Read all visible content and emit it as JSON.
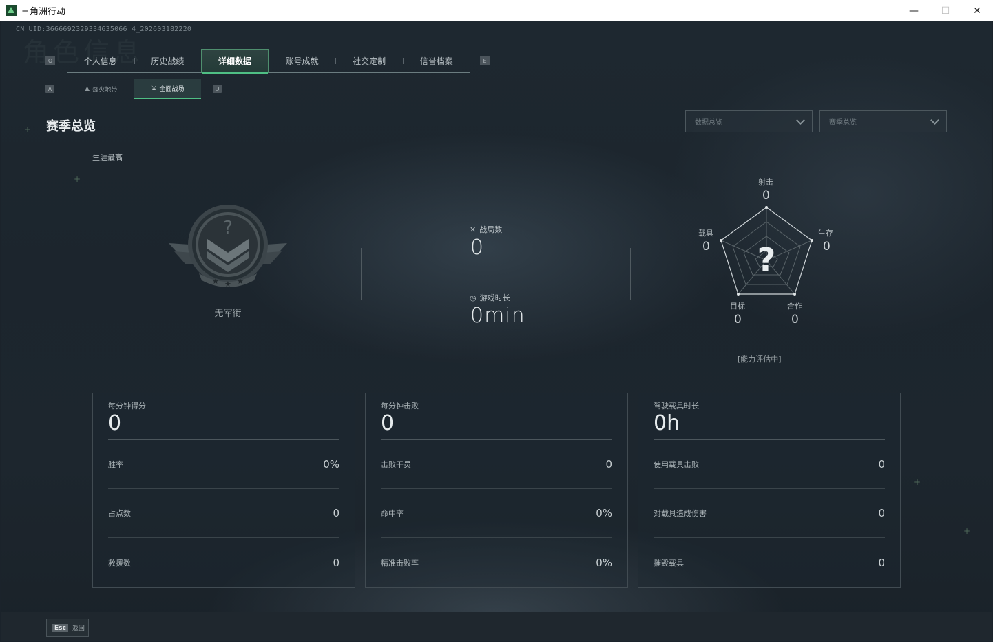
{
  "window": {
    "title": "三角洲行动",
    "controls": {
      "minimize": "—",
      "maximize": "☐",
      "close": "✕"
    }
  },
  "uid_text": "CN UID:3666692329334635066 4_202603182220",
  "watermark": "角色信息",
  "top_tabs": {
    "left_key": "Q",
    "right_key": "E",
    "items": [
      "个人信息",
      "历史战绩",
      "详细数据",
      "账号成就",
      "社交定制",
      "信誉档案"
    ],
    "active_index": 2
  },
  "sub_tabs": {
    "left_key": "A",
    "right_key": "D",
    "items": [
      "烽火地带",
      "全面战场"
    ],
    "active_index": 1
  },
  "section": {
    "title": "赛季总览",
    "dropdown_data": "数据总览",
    "dropdown_season": "赛季总览"
  },
  "career_label": "生涯最高",
  "rank": {
    "label": "无军衔",
    "icon": "rank-unknown-emblem"
  },
  "matches": {
    "label": "战局数",
    "value": "0",
    "icon": "crossed-swords-icon"
  },
  "playtime": {
    "label": "游戏时长",
    "value": "0min",
    "icon": "stopwatch-icon"
  },
  "radar": {
    "center": "?",
    "axes": [
      {
        "label": "射击",
        "value": "0"
      },
      {
        "label": "生存",
        "value": "0"
      },
      {
        "label": "合作",
        "value": "0"
      },
      {
        "label": "目标",
        "value": "0"
      },
      {
        "label": "载具",
        "value": "0"
      }
    ],
    "status": "[能力评估中]"
  },
  "cards": [
    {
      "title": "每分钟得分",
      "value": "0",
      "rows": [
        {
          "label": "胜率",
          "value": "0%"
        },
        {
          "label": "占点数",
          "value": "0"
        },
        {
          "label": "救援数",
          "value": "0"
        }
      ]
    },
    {
      "title": "每分钟击败",
      "value": "0",
      "rows": [
        {
          "label": "击败干员",
          "value": "0"
        },
        {
          "label": "命中率",
          "value": "0%"
        },
        {
          "label": "精准击败率",
          "value": "0%"
        }
      ]
    },
    {
      "title": "驾驶载具时长",
      "value": "0h",
      "rows": [
        {
          "label": "使用载具击败",
          "value": "0"
        },
        {
          "label": "对载具造成伤害",
          "value": "0"
        },
        {
          "label": "摧毁载具",
          "value": "0"
        }
      ]
    }
  ],
  "footer": {
    "esc_key": "Esc",
    "esc_label": "返回"
  },
  "colors": {
    "accent": "#4fbf84",
    "background": "#1b232b"
  }
}
